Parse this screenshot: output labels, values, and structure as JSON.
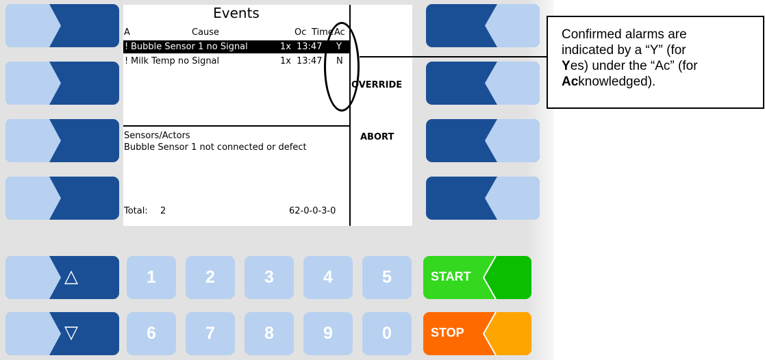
{
  "screen": {
    "title": "Events",
    "headers": {
      "a": "A",
      "cause": "Cause",
      "oc": "Oc",
      "time": "Time",
      "ac": "Ac"
    },
    "rows": [
      {
        "mark": "!",
        "cause": "Bubble Sensor 1 no Signal",
        "oc": "1x",
        "time": "13:47",
        "ac": "Y",
        "selected": true
      },
      {
        "mark": "!",
        "cause": "Milk Temp no Signal",
        "oc": "1x",
        "time": "13:47",
        "ac": "N",
        "selected": false
      }
    ],
    "side_labels": {
      "override": "OVERRIDE",
      "abort": "ABORT"
    },
    "category": "Sensors/Actors",
    "description": "Bubble Sensor 1 not connected or defect",
    "total_label": "Total:",
    "total_value": "2",
    "code": "62-0-0-3-0"
  },
  "keypad": {
    "row1": [
      "1",
      "2",
      "3",
      "4",
      "5"
    ],
    "row2": [
      "6",
      "7",
      "8",
      "9",
      "0"
    ],
    "up_arrow": "△",
    "down_arrow": "▽",
    "start": "START",
    "stop": "STOP"
  },
  "callout": {
    "line1": "Confirmed alarms are",
    "line2_a": "indicated by a “Y” (for",
    "line3_bold": "Y",
    "line3_rest": "es) under the “Ac” (for",
    "line4_bold": "Ac",
    "line4_rest": "knowledged)."
  },
  "colors": {
    "softkey_dark": "#1a4f96",
    "softkey_light": "#b8d1f1",
    "start": "#33d81f",
    "start_light": "#0bbf00",
    "stop": "#ff6a00",
    "stop_light": "#ffa500",
    "panel": "#e2e2e2"
  }
}
